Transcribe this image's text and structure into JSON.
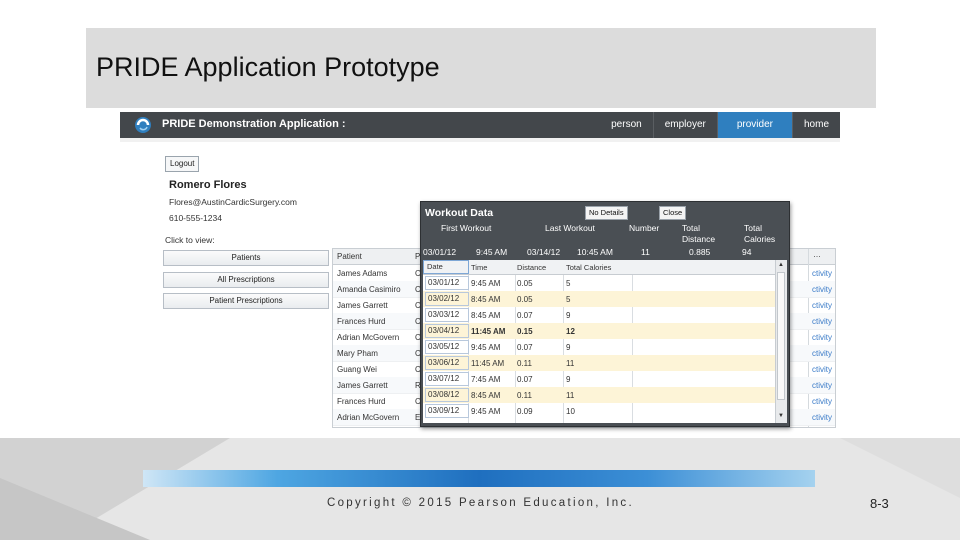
{
  "slide": {
    "title": "PRIDE Application Prototype"
  },
  "app": {
    "title": "PRIDE Demonstration Application :",
    "nav": [
      {
        "label": "person"
      },
      {
        "label": "employer"
      },
      {
        "label": "provider"
      },
      {
        "label": "home"
      }
    ]
  },
  "sidebar": {
    "logout": "Logout",
    "user_name": "Romero Flores",
    "email": "Flores@AustinCardicSurgery.com",
    "phone": "610-555-1234",
    "click_label": "Click to view:",
    "buttons": [
      {
        "label": "Patients"
      },
      {
        "label": "All Prescriptions"
      },
      {
        "label": "Patient Prescriptions"
      }
    ]
  },
  "patients": {
    "header": "Patient",
    "header_p": "P",
    "header_dots": "…",
    "rows": [
      {
        "name": "James Adams",
        "code": "C",
        "link": "ctivity"
      },
      {
        "name": "Amanda Casimiro",
        "code": "C",
        "link": "ctivity"
      },
      {
        "name": "James Garrett",
        "code": "C",
        "link": "ctivity"
      },
      {
        "name": "Frances Hurd",
        "code": "C",
        "link": "ctivity"
      },
      {
        "name": "Adrian McGovern",
        "code": "C",
        "link": "ctivity"
      },
      {
        "name": "Mary Pham",
        "code": "C",
        "link": "ctivity"
      },
      {
        "name": "Guang Wei",
        "code": "C",
        "link": "ctivity"
      },
      {
        "name": "James Garrett",
        "code": "R",
        "link": "ctivity"
      },
      {
        "name": "Frances Hurd",
        "code": "C",
        "link": "ctivity"
      },
      {
        "name": "Adrian McGovern",
        "code": "E",
        "link": "ctivity"
      }
    ]
  },
  "workout": {
    "title": "Workout Data",
    "no_details": "No Details",
    "close": "Close",
    "summary_headers": {
      "first": "First Workout",
      "last": "Last Workout",
      "number": "Number",
      "total_distance_1": "Total",
      "total_distance_2": "Distance",
      "total_calories_1": "Total",
      "total_calories_2": "Calories"
    },
    "summary_values": {
      "first_date": "03/01/12",
      "first_time": "9:45 AM",
      "last_date": "03/14/12",
      "last_time": "10:45 AM",
      "number": "11",
      "total_distance": "0.885",
      "total_calories": "94"
    },
    "columns": {
      "date": "Date",
      "time": "Time",
      "distance": "Distance",
      "calories": "Total Calories"
    },
    "rows": [
      {
        "date": "03/01/12",
        "time": "9:45 AM",
        "distance": "0.05",
        "calories": "5"
      },
      {
        "date": "03/02/12",
        "time": "8:45 AM",
        "distance": "0.05",
        "calories": "5"
      },
      {
        "date": "03/03/12",
        "time": "8:45 AM",
        "distance": "0.07",
        "calories": "9"
      },
      {
        "date": "03/04/12",
        "time": "11:45 AM",
        "distance": "0.15",
        "calories": "12"
      },
      {
        "date": "03/05/12",
        "time": "9:45 AM",
        "distance": "0.07",
        "calories": "9"
      },
      {
        "date": "03/06/12",
        "time": "11:45 AM",
        "distance": "0.11",
        "calories": "11"
      },
      {
        "date": "03/07/12",
        "time": "7:45 AM",
        "distance": "0.07",
        "calories": "9"
      },
      {
        "date": "03/08/12",
        "time": "8:45 AM",
        "distance": "0.11",
        "calories": "11"
      },
      {
        "date": "03/09/12",
        "time": "9:45 AM",
        "distance": "0.09",
        "calories": "10"
      }
    ]
  },
  "footer": {
    "copyright": "Copyright © 2015 Pearson Education, Inc.",
    "page": "8-3"
  },
  "colors": {
    "header": "#43474b",
    "nav_active": "#2f7fbf",
    "popup": "#4a4f54",
    "row_highlight": "#fdf4d7",
    "link": "#3a7bc8"
  }
}
